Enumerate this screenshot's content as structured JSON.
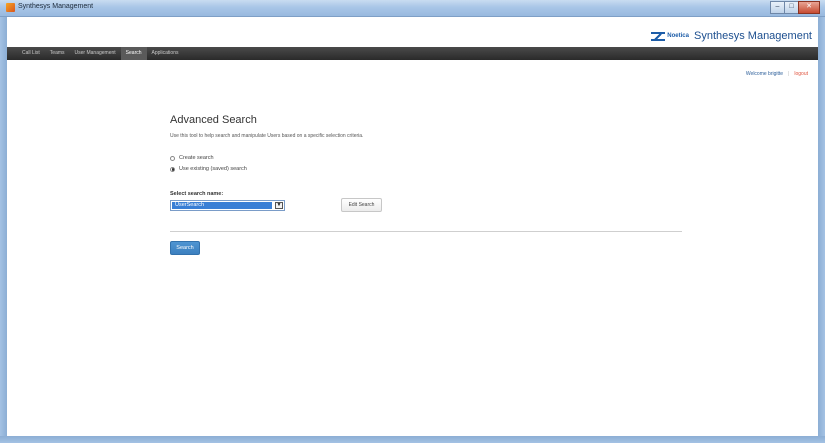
{
  "window": {
    "title": "Synthesys Management",
    "controls": {
      "minimize": "–",
      "maximize": "□",
      "close": "✕"
    }
  },
  "brand": {
    "small": "Noetica",
    "big": "Synthesys Management"
  },
  "nav": {
    "items": [
      {
        "label": "Call List",
        "active": false
      },
      {
        "label": "Teams",
        "active": false
      },
      {
        "label": "User Management",
        "active": false
      },
      {
        "label": "Search",
        "active": true
      },
      {
        "label": "Applications",
        "active": false
      }
    ]
  },
  "userbar": {
    "welcome": "Welcome brigitte",
    "separator": "|",
    "logout": "logout"
  },
  "main": {
    "heading": "Advanced Search",
    "description": "Use this tool to help search and manipulate Users based on a specific selection criteria.",
    "options": [
      {
        "label": "Create search",
        "checked": false
      },
      {
        "label": "Use existing (saved) search",
        "checked": true
      }
    ],
    "select_label": "Select search name:",
    "select_value": "UserSearch",
    "edit_button": "Edit Search",
    "search_button": "Search"
  },
  "colors": {
    "accent": "#3b7fbf",
    "brand": "#1d5da8",
    "logout": "#e0543f"
  }
}
